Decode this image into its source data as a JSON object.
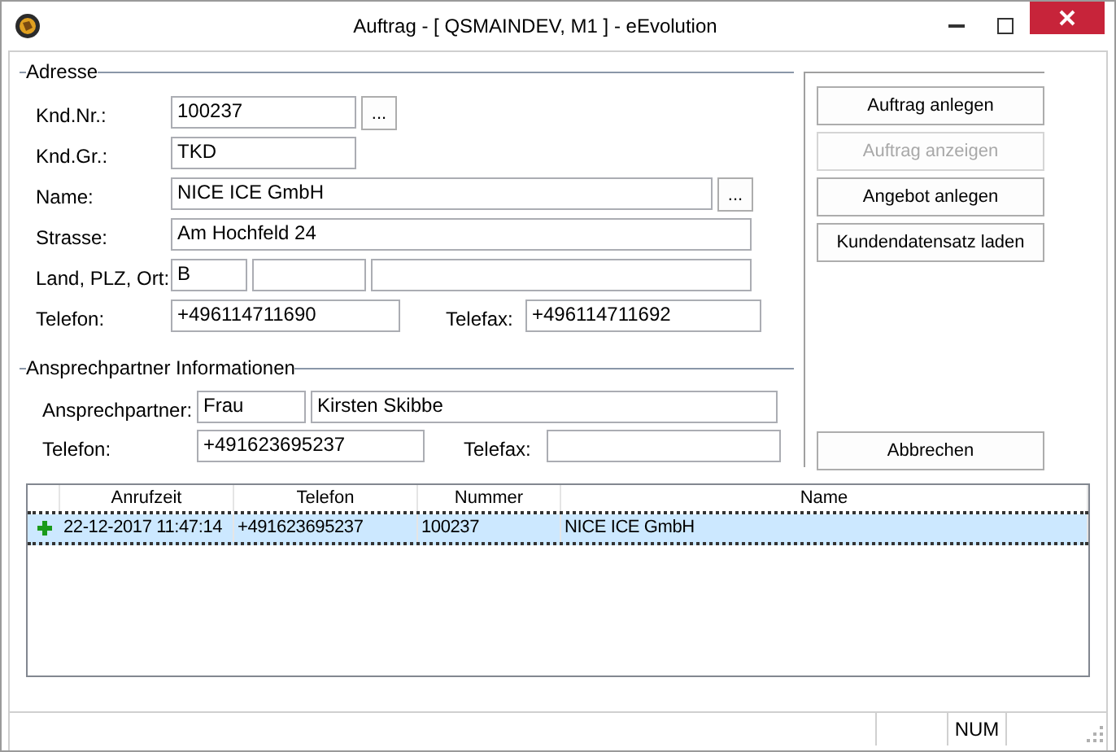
{
  "window": {
    "title": "Auftrag - [ QSMAINDEV, M1 ]  -  eEvolution"
  },
  "address": {
    "title": "Adresse",
    "customer_no": {
      "label": "Knd.Nr.:",
      "value": "100237",
      "button": "..."
    },
    "customer_group": {
      "label": "Knd.Gr.:",
      "value": "TKD"
    },
    "name": {
      "label": "Name:",
      "value": "NICE ICE GmbH",
      "button": "..."
    },
    "street": {
      "label": "Strasse:",
      "value": "Am Hochfeld 24"
    },
    "location": {
      "label": "Land, PLZ, Ort:",
      "country": "B"
    },
    "phone": {
      "label": "Telefon:",
      "value": "+496114711690"
    },
    "fax": {
      "label": "Telefax:",
      "value": "+496114711692"
    }
  },
  "contact": {
    "title": "Ansprechpartner Informationen",
    "person": {
      "label": "Ansprechpartner:",
      "salutation": "Frau",
      "name": "Kirsten Skibbe"
    },
    "phone": {
      "label": "Telefon:",
      "value": "+491623695237"
    },
    "fax": {
      "label": "Telefax:"
    }
  },
  "actions": [
    {
      "label": "Auftrag anlegen",
      "disabled": false
    },
    {
      "label": "Auftrag anzeigen",
      "disabled": true
    },
    {
      "label": "Angebot anlegen",
      "disabled": false
    },
    {
      "label": "Kundendatensatz laden",
      "disabled": false
    }
  ],
  "cancel_button": "Abbrechen",
  "table": {
    "columns": [
      "Anrufzeit",
      "Telefon",
      "Nummer",
      "Name"
    ],
    "rows": [
      {
        "selected": true,
        "cells": [
          "22-12-2017 11:47:14",
          "+491623695237",
          "100237",
          "NICE ICE GmbH"
        ]
      }
    ]
  },
  "status_bar": {
    "num": "NUM"
  }
}
